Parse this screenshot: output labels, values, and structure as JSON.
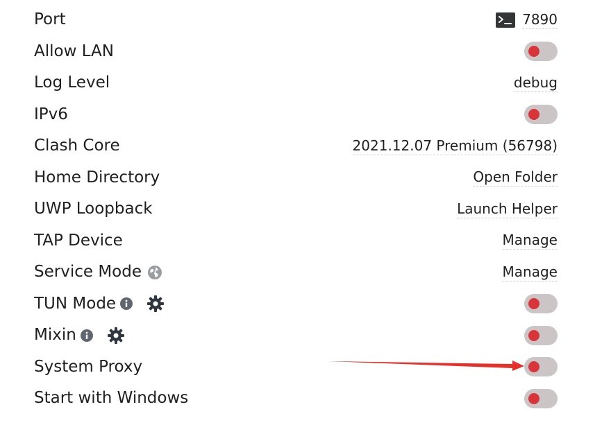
{
  "colors": {
    "toggle_track": "#ccc5c5",
    "toggle_knob": "#d8353a",
    "arrow": "#e8302a",
    "icon_dark": "#2f3640",
    "icon_grey": "#9a9ea3"
  },
  "settings": {
    "port": {
      "label": "Port",
      "value": "7890",
      "icon": "terminal-icon"
    },
    "allow_lan": {
      "label": "Allow LAN",
      "toggle": "off"
    },
    "log_level": {
      "label": "Log Level",
      "value": "debug"
    },
    "ipv6": {
      "label": "IPv6",
      "toggle": "off"
    },
    "clash_core": {
      "label": "Clash Core",
      "value": "2021.12.07 Premium (56798)"
    },
    "home_directory": {
      "label": "Home Directory",
      "value": "Open Folder"
    },
    "uwp_loopback": {
      "label": "UWP Loopback",
      "value": "Launch Helper"
    },
    "tap_device": {
      "label": "TAP Device",
      "value": "Manage"
    },
    "service_mode": {
      "label": "Service Mode",
      "value": "Manage",
      "icon": "globe-icon"
    },
    "tun_mode": {
      "label": "TUN Mode",
      "toggle": "off",
      "icons": [
        "info-icon",
        "gear-icon"
      ]
    },
    "mixin": {
      "label": "Mixin",
      "toggle": "off",
      "icons": [
        "info-icon",
        "gear-icon"
      ]
    },
    "system_proxy": {
      "label": "System Proxy",
      "toggle": "off"
    },
    "start_with_windows": {
      "label": "Start with Windows",
      "toggle": "off"
    }
  }
}
